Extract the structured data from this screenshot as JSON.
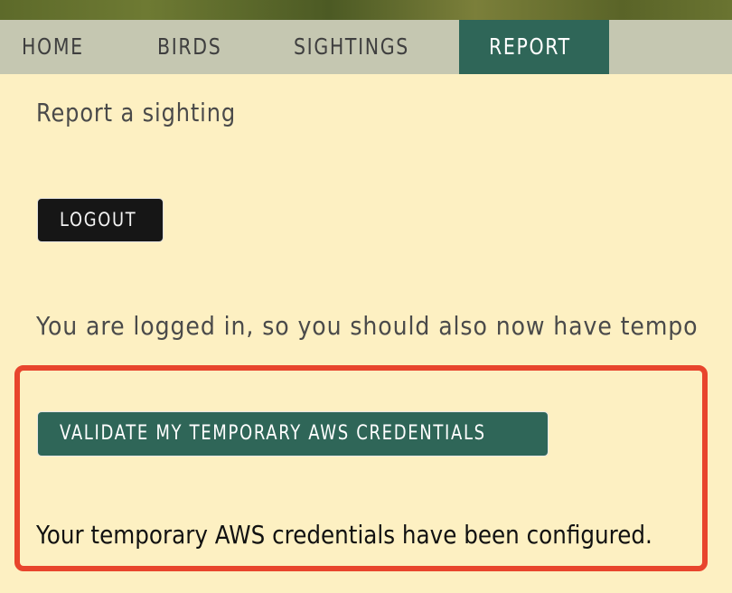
{
  "nav": {
    "items": [
      {
        "label": "HOME"
      },
      {
        "label": "BIRDS"
      },
      {
        "label": "SIGHTINGS"
      },
      {
        "label": "REPORT"
      }
    ],
    "active": "REPORT"
  },
  "main": {
    "heading": "Report a sighting",
    "logout_label": "LOGOUT",
    "logged_in_text": "You are logged in, so you should also now have tempo",
    "validate_label": "VALIDATE MY TEMPORARY AWS CREDENTIALS",
    "status_text": "Your temporary AWS credentials have been configured."
  },
  "colors": {
    "background": "#fdf0c2",
    "nav_background": "#c5c7b1",
    "accent": "#2f6658",
    "logout_button": "#161616",
    "highlight_border": "#e8452d"
  }
}
